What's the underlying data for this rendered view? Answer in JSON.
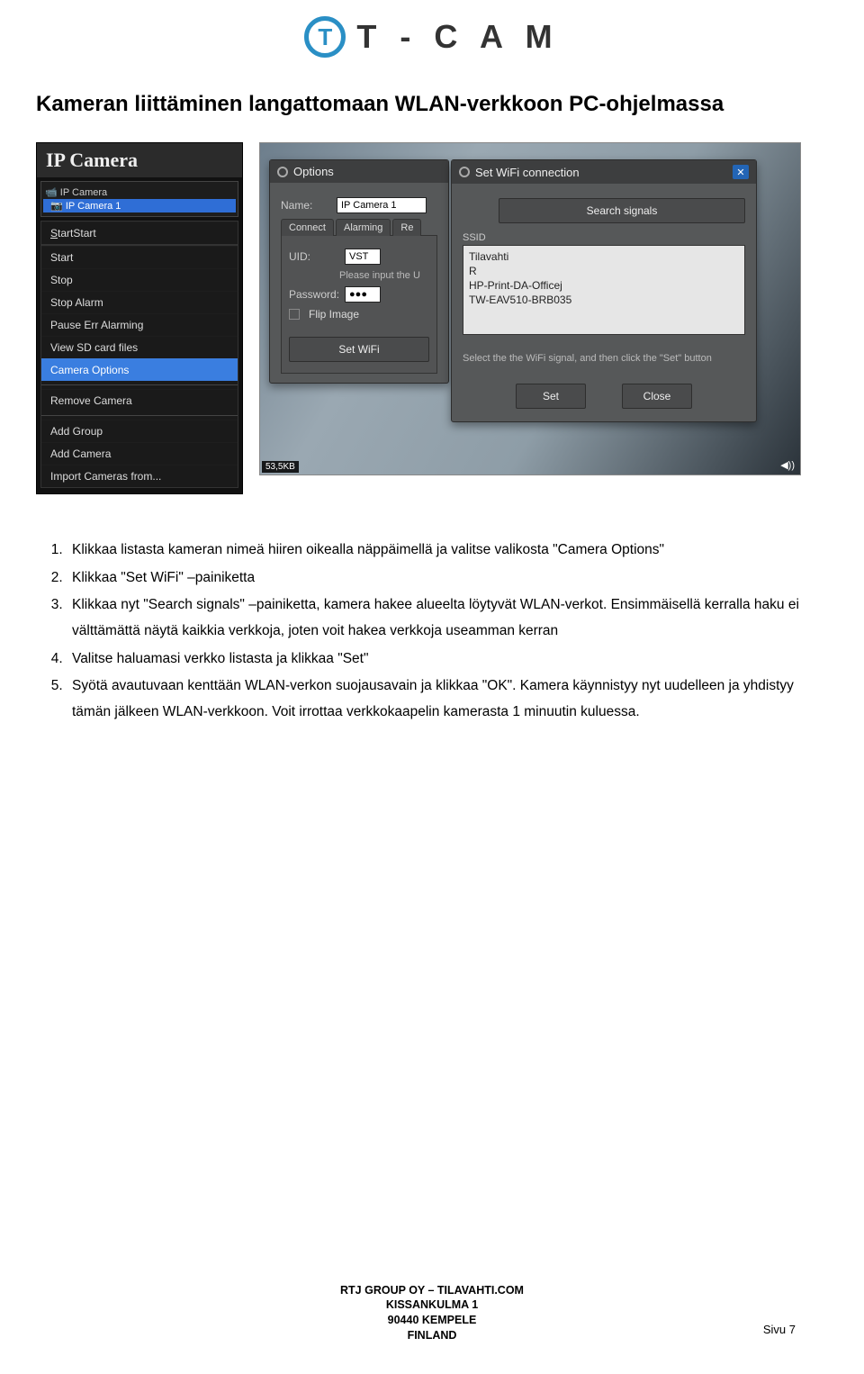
{
  "brand": {
    "letter": "T",
    "name": "T - C A M"
  },
  "page_title": "Kameran liittäminen langattomaan WLAN-verkkoon PC-ohjelmassa",
  "left_ss": {
    "app_title": "IP Camera",
    "tree": {
      "root": "IP Camera",
      "child_selected": "IP Camera 1"
    },
    "menu": {
      "start": "Start",
      "stop": "Stop",
      "stop_alarm": "Stop Alarm",
      "pause_err": "Pause Err Alarming",
      "view_sd": "View SD card files",
      "camera_options": "Camera Options",
      "remove_camera": "Remove Camera",
      "add_group": "Add Group",
      "add_camera": "Add Camera",
      "import_cameras": "Import Cameras from..."
    }
  },
  "right_ss": {
    "options": {
      "title": "Options",
      "name_label": "Name:",
      "name_value": "IP Camera 1",
      "tabs": {
        "connect": "Connect",
        "alarming": "Alarming",
        "re": "Re"
      },
      "uid_label": "UID:",
      "uid_value": "VST",
      "uid_hint": "Please input the U",
      "password_label": "Password:",
      "password_value": "●●●",
      "flip_label": "Flip Image",
      "set_wifi_btn": "Set WiFi"
    },
    "wifi": {
      "title": "Set WiFi connection",
      "search_btn": "Search signals",
      "ssid_header": "SSID",
      "ssids": [
        "Tilavahti",
        "R",
        "HP-Print-DA-Officej",
        "TW-EAV510-BRB035"
      ],
      "hint": "Select the the WiFi signal, and then click the \"Set\" button",
      "set_btn": "Set",
      "close_btn": "Close"
    },
    "status_kb": "53,5KB",
    "volume": "◀))"
  },
  "instructions": [
    "Klikkaa listasta kameran nimeä hiiren oikealla näppäimellä ja valitse valikosta \"Camera Options\"",
    "Klikkaa \"Set WiFi\" –painiketta",
    "Klikkaa nyt \"Search signals\" –painiketta, kamera hakee alueelta löytyvät WLAN-verkot. Ensimmäisellä kerralla haku ei välttämättä näytä kaikkia verkkoja, joten voit hakea verkkoja useamman kerran",
    "Valitse haluamasi verkko listasta ja klikkaa \"Set\"",
    "Syötä avautuvaan kenttään WLAN-verkon suojausavain ja klikkaa \"OK\". Kamera käynnistyy nyt uudelleen ja yhdistyy tämän jälkeen WLAN-verkkoon. Voit irrottaa verkkokaapelin kamerasta 1 minuutin kuluessa."
  ],
  "footer": {
    "line1": "RTJ GROUP OY – TILAVAHTI.COM",
    "line2": "KISSANKULMA 1",
    "line3": "90440 KEMPELE",
    "line4": "FINLAND"
  },
  "page_number": "Sivu 7"
}
